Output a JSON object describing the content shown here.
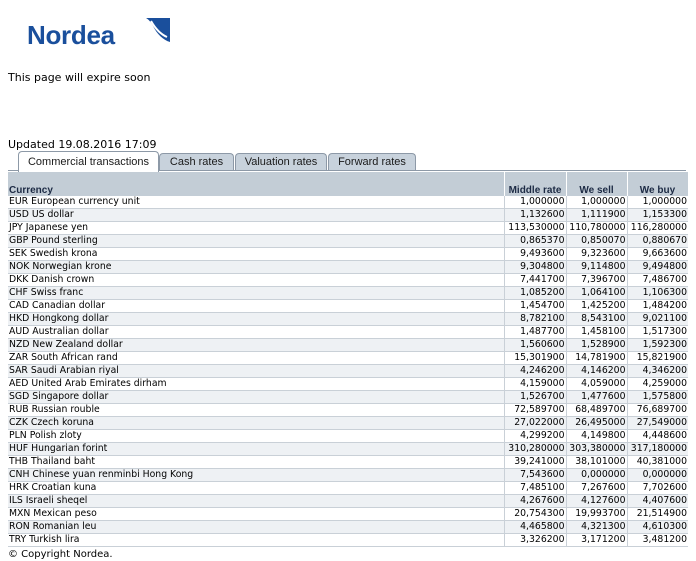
{
  "brand": {
    "name": "Nordea",
    "color": "#1a4f9c"
  },
  "notice": "This page will expire soon",
  "updated": "Updated 19.08.2016 17:09",
  "tabs": [
    {
      "label": "Commercial transactions",
      "active": true
    },
    {
      "label": "Cash rates",
      "active": false
    },
    {
      "label": "Valuation rates",
      "active": false
    },
    {
      "label": "Forward rates",
      "active": false
    }
  ],
  "table": {
    "headers": {
      "currency": "Currency",
      "middle": "Middle rate",
      "sell": "We sell",
      "buy": "We buy"
    },
    "rows": [
      [
        "EUR European currency unit",
        "1,000000",
        "1,000000",
        "1,000000"
      ],
      [
        "USD US dollar",
        "1,132600",
        "1,111900",
        "1,153300"
      ],
      [
        "JPY Japanese yen",
        "113,530000",
        "110,780000",
        "116,280000"
      ],
      [
        "GBP Pound sterling",
        "0,865370",
        "0,850070",
        "0,880670"
      ],
      [
        "SEK Swedish krona",
        "9,493600",
        "9,323600",
        "9,663600"
      ],
      [
        "NOK Norwegian krone",
        "9,304800",
        "9,114800",
        "9,494800"
      ],
      [
        "DKK Danish crown",
        "7,441700",
        "7,396700",
        "7,486700"
      ],
      [
        "CHF Swiss franc",
        "1,085200",
        "1,064100",
        "1,106300"
      ],
      [
        "CAD Canadian dollar",
        "1,454700",
        "1,425200",
        "1,484200"
      ],
      [
        "HKD Hongkong dollar",
        "8,782100",
        "8,543100",
        "9,021100"
      ],
      [
        "AUD Australian dollar",
        "1,487700",
        "1,458100",
        "1,517300"
      ],
      [
        "NZD New Zealand dollar",
        "1,560600",
        "1,528900",
        "1,592300"
      ],
      [
        "ZAR South African rand",
        "15,301900",
        "14,781900",
        "15,821900"
      ],
      [
        "SAR Saudi Arabian riyal",
        "4,246200",
        "4,146200",
        "4,346200"
      ],
      [
        "AED United Arab Emirates dirham",
        "4,159000",
        "4,059000",
        "4,259000"
      ],
      [
        "SGD Singapore dollar",
        "1,526700",
        "1,477600",
        "1,575800"
      ],
      [
        "RUB Russian rouble",
        "72,589700",
        "68,489700",
        "76,689700"
      ],
      [
        "CZK Czech koruna",
        "27,022000",
        "26,495000",
        "27,549000"
      ],
      [
        "PLN Polish zloty",
        "4,299200",
        "4,149800",
        "4,448600"
      ],
      [
        "HUF Hungarian forint",
        "310,280000",
        "303,380000",
        "317,180000"
      ],
      [
        "THB Thailand baht",
        "39,241000",
        "38,101000",
        "40,381000"
      ],
      [
        "CNH Chinese yuan renminbi Hong Kong",
        "7,543600",
        "0,000000",
        "0,000000"
      ],
      [
        "HRK Croatian kuna",
        "7,485100",
        "7,267600",
        "7,702600"
      ],
      [
        "ILS Israeli sheqel",
        "4,267600",
        "4,127600",
        "4,407600"
      ],
      [
        "MXN Mexican peso",
        "20,754300",
        "19,993700",
        "21,514900"
      ],
      [
        "RON Romanian leu",
        "4,465800",
        "4,321300",
        "4,610300"
      ],
      [
        "TRY Turkish lira",
        "3,326200",
        "3,171200",
        "3,481200"
      ]
    ]
  },
  "footer": "© Copyright Nordea."
}
